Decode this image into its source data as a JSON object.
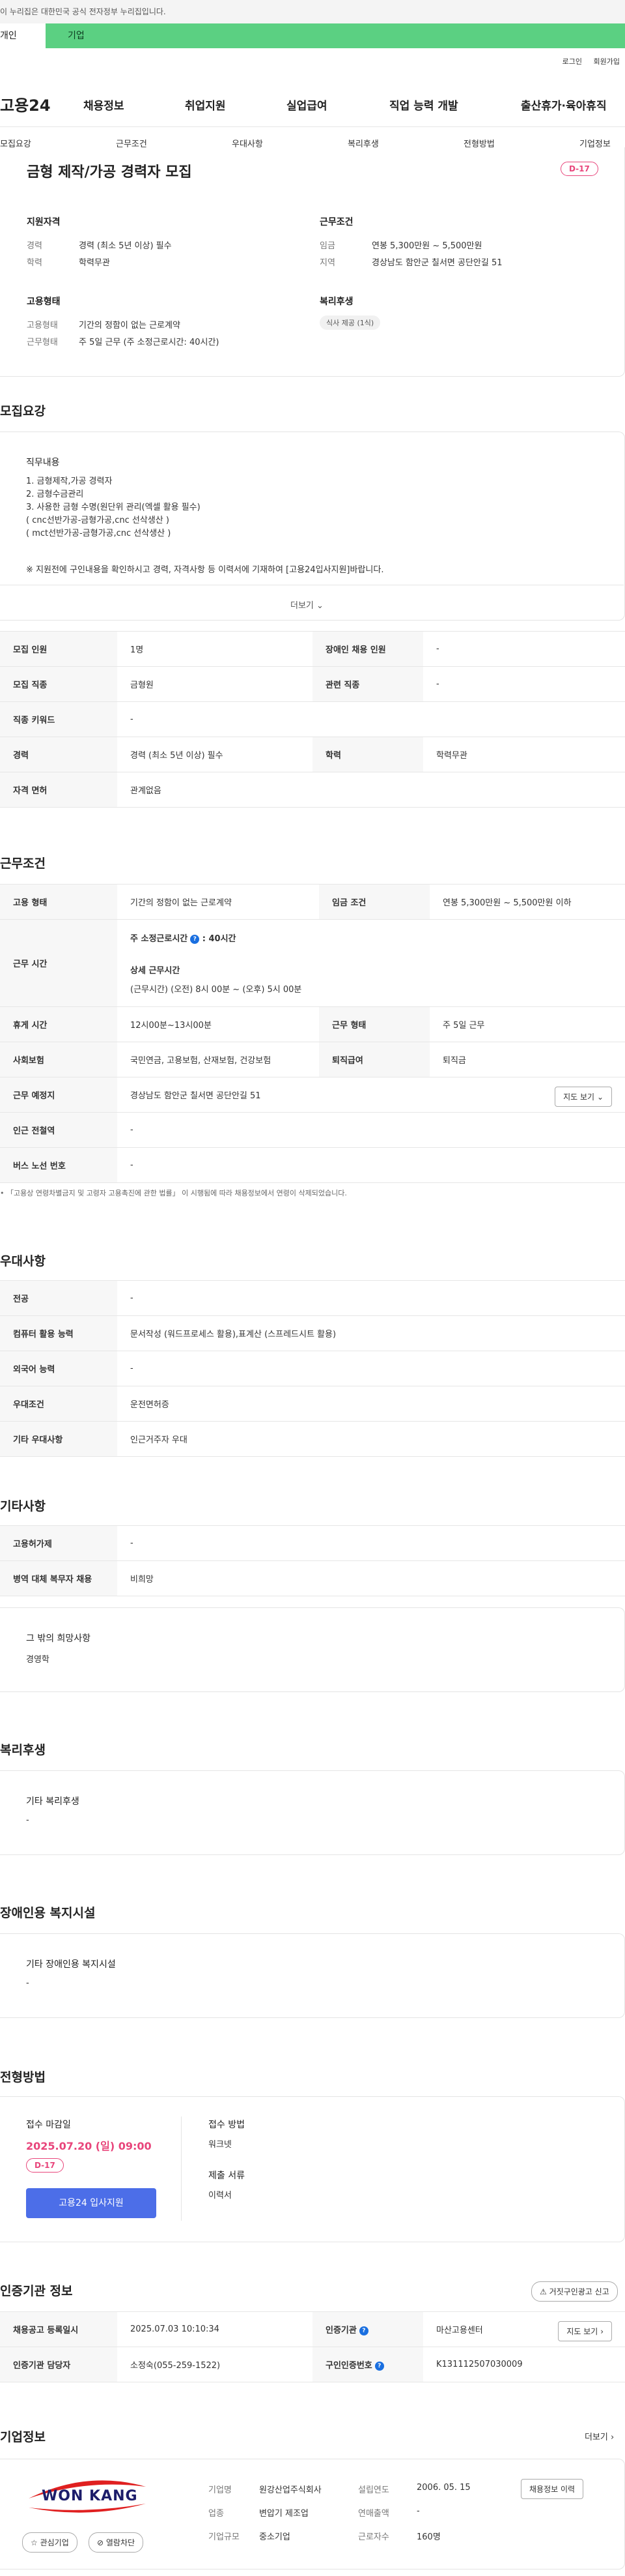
{
  "gov_banner": {
    "text": "이 누리집은 대한민국 공식 전자정부 누리집입니다."
  },
  "global_tabs": [
    {
      "label": "개인"
    },
    {
      "label": "기업"
    }
  ],
  "util": {
    "login": "로그인",
    "join": "회원가입"
  },
  "header": {
    "logo": "고용24",
    "nav": [
      "채용정보",
      "취업지원",
      "실업급여",
      "직업 능력 개발",
      "출산휴가·육아휴직"
    ]
  },
  "sub_nav": [
    "모집요강",
    "근무조건",
    "우대사항",
    "복리후생",
    "전형방법",
    "기업정보"
  ],
  "job": {
    "title": "금형 제작/가공 경력자 모집",
    "dday": "D-17",
    "qual_title": "지원자격",
    "qual": [
      {
        "k": "경력",
        "v": "경력 (최소 5년 이상) 필수"
      },
      {
        "k": "학력",
        "v": "학력무관"
      }
    ],
    "cond_title": "근무조건",
    "cond": [
      {
        "k": "임금",
        "v": "연봉 5,300만원 ~ 5,500만원"
      },
      {
        "k": "지역",
        "v": "경상남도 함안군 칠서면 공단안길 51"
      }
    ],
    "emp_title": "고용형태",
    "emp": [
      {
        "k": "고용형태",
        "v": "기간의 정함이 없는 근로계약"
      },
      {
        "k": "근무형태",
        "v": "주 5일 근무 (주 소정근로시간: 40시간)"
      }
    ],
    "welfare_title": "복리후생",
    "welfare_chip": "식사 제공 (1식)"
  },
  "recruit": {
    "section": "모집요강",
    "duty_title": "직무내용",
    "duty_lines": [
      "1. 금형제작,가공 경력자",
      "2. 금형수금관리",
      "3. 사용한 금형 수명(원단위 관리(엑셀 활용 필수)",
      "( cnc선반가공-금형가공,cnc 선삭생산 )",
      "( mct선반가공-금형가공,cnc 선삭생산 )"
    ],
    "notice": "※ 지원전에 구인내용을 확인하시고 경력, 자격사항 등 이력서에 기재하여 [고용24입사지원]바랍니다.",
    "more": "더보기",
    "rows": [
      {
        "k1": "모집 인원",
        "v1": "1명",
        "k2": "장애인 채용 인원",
        "v2": "-"
      },
      {
        "k1": "모집 직종",
        "v1": "금형원",
        "k2": "관련 직종",
        "v2": "-"
      },
      {
        "k1": "직종 키워드",
        "v1": "-"
      },
      {
        "k1": "경력",
        "v1": "경력 (최소 5년 이상) 필수",
        "k2": "학력",
        "v2": "학력무관"
      },
      {
        "k1": "자격 면허",
        "v1": "관계없음"
      }
    ]
  },
  "work": {
    "section": "근무조건",
    "emp_k": "고용 형태",
    "emp_v": "기간의 정함이 없는 근로계약",
    "pay_k": "임금 조건",
    "pay_v": "연봉 5,300만원 ~ 5,500만원 이하",
    "time_k": "근무 시간",
    "time_std": "주 소정근로시간",
    "time_std_v": ": 40시간",
    "time_detail_title": "상세 근무시간",
    "time_detail_v": "(근무시간) (오전) 8시 00분 ~ (오후) 5시 00분",
    "rest_k": "휴게 시간",
    "rest_v": "12시00분~13시00분",
    "form_k": "근무 형태",
    "form_v": "주 5일 근무",
    "ins_k": "사회보험",
    "ins_v": "국민연금, 고용보험, 산재보험, 건강보험",
    "sev_k": "퇴직급여",
    "sev_v": "퇴직금",
    "place_k": "근무 예정지",
    "place_v": "경상남도 함안군 칠서면 공단안길 51",
    "map_btn": "지도 보기",
    "subway_k": "인근 전철역",
    "subway_v": "-",
    "bus_k": "버스 노선 번호",
    "bus_v": "-",
    "footnote": "「고용상 연령차별금지 및 고령자 고용촉진에 관한 법률」 이 시행됨에 따라 채용정보에서 연령이 삭제되었습니다."
  },
  "pref": {
    "section": "우대사항",
    "rows": [
      {
        "k": "전공",
        "v": "-"
      },
      {
        "k": "컴퓨터 활용 능력",
        "v": "문서작성 (워드프로세스 활용),표계산 (스프레드시트 활용)"
      },
      {
        "k": "외국어 능력",
        "v": "-"
      },
      {
        "k": "우대조건",
        "v": "운전면허증"
      },
      {
        "k": "기타 우대사항",
        "v": "인근거주자 우대"
      }
    ]
  },
  "etc": {
    "section": "기타사항",
    "rows": [
      {
        "k": "고용허가제",
        "v": "-"
      },
      {
        "k": "병역 대체 복무자 채용",
        "v": "비희망"
      }
    ],
    "other_title": "그 밖의 희망사항",
    "other_v": "경영학"
  },
  "welfare": {
    "section": "복리후생",
    "title": "기타 복리후생",
    "v": "-"
  },
  "disab": {
    "section": "장애인용 복지시설",
    "title": "기타 장애인용 복지시설",
    "v": "-"
  },
  "process": {
    "section": "전형방법",
    "deadline_k": "접수 마감일",
    "deadline_v": "2025.07.20 (일) 09:00",
    "dday": "D-17",
    "apply_btn": "고용24 입사지원",
    "method_k": "접수 방법",
    "method_v": "워크넷",
    "docs_k": "제출 서류",
    "docs_v": "이력서"
  },
  "cert": {
    "section": "인증기관 정보",
    "report_btn": "거짓구인광고 신고",
    "date_k": "채용공고 등록일시",
    "date_v": "2025.07.03 10:10:34",
    "org_k": "인증기관",
    "org_v": "마산고용센터",
    "map_btn": "지도 보기",
    "mgr_k": "인증기관 담당자",
    "mgr_v": "소정숙(055-259-1522)",
    "no_k": "구인인증번호",
    "no_v": "K131112507030009"
  },
  "company": {
    "section": "기업정보",
    "more": "더보기",
    "logo_text": "WON KANG",
    "fav_btn": "관심기업",
    "block_btn": "열람차단",
    "rows": [
      {
        "k": "기업명",
        "v": "원강산업주식회사",
        "k2": "설립연도",
        "v2": "2006. 05. 15"
      },
      {
        "k": "업종",
        "v": "변압기 제조업",
        "k2": "연매출액",
        "v2": "-"
      },
      {
        "k": "기업규모",
        "v": "중소기업",
        "k2": "근로자수",
        "v2": "160명"
      }
    ],
    "history_btn": "채용정보 이력"
  }
}
